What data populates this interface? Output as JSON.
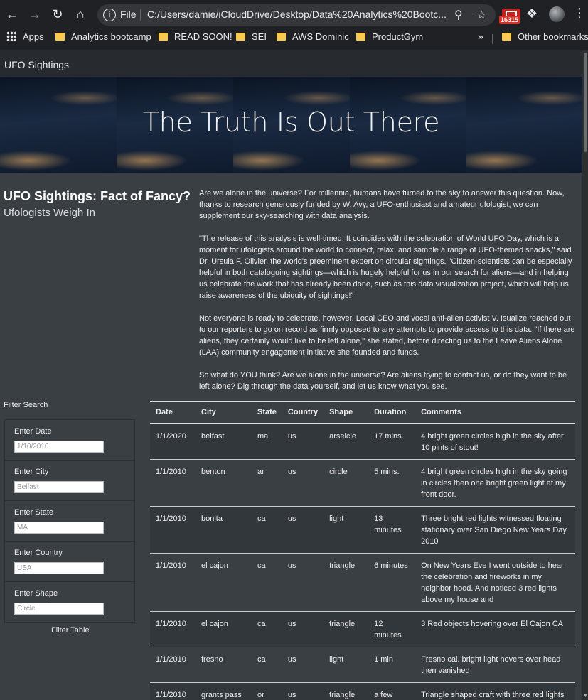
{
  "browser": {
    "omnibox_scheme": "File",
    "url": "C:/Users/damie/iCloudDrive/Desktop/Data%20Analytics%20Bootc...",
    "mail_badge": "16315",
    "bookmarks": [
      "Apps",
      "Analytics bootcamp",
      "READ SOON!",
      "SEI",
      "AWS Dominic",
      "ProductGym"
    ],
    "other_bookmarks": "Other bookmarks",
    "overflow": "»"
  },
  "nav": {
    "brand": "UFO Sightings"
  },
  "hero": {
    "title": "The Truth Is Out There"
  },
  "article": {
    "title": "UFO Sightings: Fact of Fancy?",
    "subtitle": "Ufologists Weigh In",
    "paragraphs": [
      "Are we alone in the universe? For millennia, humans have turned to the sky to answer this question. Now, thanks to research generously funded by W. Avy, a UFO-enthusiast and amateur ufologist, we can supplement our sky-searching with data analysis.",
      "\"The release of this analysis is well-timed: It coincides with the celebration of World UFO Day, which is a moment for ufologists around the world to connect, relax, and sample a range of UFO-themed snacks,\" said Dr. Ursula F. Olivier, the world's preeminent expert on circular sightings. \"Citizen-scientists can be especially helpful in both cataloguing sightings—which is hugely helpful for us in our search for aliens—and in helping us celebrate the work that has already been done, such as this data visualization project, which will help us raise awareness of the ubiquity of sightings!\"",
      "Not everyone is ready to celebrate, however. Local CEO and vocal anti-alien activist V. Isualize reached out to our reporters to go on record as firmly opposed to any attempts to provide access to this data. \"If there are aliens, they certainly would like to be left alone,\" she stated, before directing us to the Leave Aliens Alone (LAA) community engagement initiative she founded and funds.",
      "So what do YOU think? Are we alone in the universe? Are aliens trying to contact us, or do they want to be left alone? Dig through the data yourself, and let us know what you see."
    ]
  },
  "filters": {
    "heading": "Filter Search",
    "items": [
      {
        "label": "Enter Date",
        "placeholder": "1/10/2010"
      },
      {
        "label": "Enter City",
        "placeholder": "Belfast"
      },
      {
        "label": "Enter State",
        "placeholder": "MA"
      },
      {
        "label": "Enter Country",
        "placeholder": "USA"
      },
      {
        "label": "Enter Shape",
        "placeholder": "Circle"
      }
    ],
    "button": "Filter Table"
  },
  "table": {
    "headers": [
      "Date",
      "City",
      "State",
      "Country",
      "Shape",
      "Duration",
      "Comments"
    ],
    "rows": [
      [
        "1/1/2020",
        "belfast",
        "ma",
        "us",
        "arseicle",
        "17 mins.",
        "4 bright green circles high in the sky after 10 pints of stout!"
      ],
      [
        "1/1/2010",
        "benton",
        "ar",
        "us",
        "circle",
        "5 mins.",
        "4 bright green circles high in the sky going in circles then one bright green light at my front door."
      ],
      [
        "1/1/2010",
        "bonita",
        "ca",
        "us",
        "light",
        "13 minutes",
        "Three bright red lights witnessed floating stationary over San Diego New Years Day 2010"
      ],
      [
        "1/1/2010",
        "el cajon",
        "ca",
        "us",
        "triangle",
        "6 minutes",
        "On New Years Eve I went outside to hear the celebration and fireworks in my neighbor hood. And noticed 3 red lights above my house and"
      ],
      [
        "1/1/2010",
        "el cajon",
        "ca",
        "us",
        "triangle",
        "12 minutes",
        "3 Red objects hovering over El Cajon CA"
      ],
      [
        "1/1/2010",
        "fresno",
        "ca",
        "us",
        "light",
        "1 min",
        "Fresno cal. bright light hovers over head then vanished"
      ],
      [
        "1/1/2010",
        "grants pass",
        "or",
        "us",
        "triangle",
        "a few minutes",
        "Triangle shaped craft with three red lights at each bottom corner. Grants Pass, OR"
      ]
    ]
  }
}
